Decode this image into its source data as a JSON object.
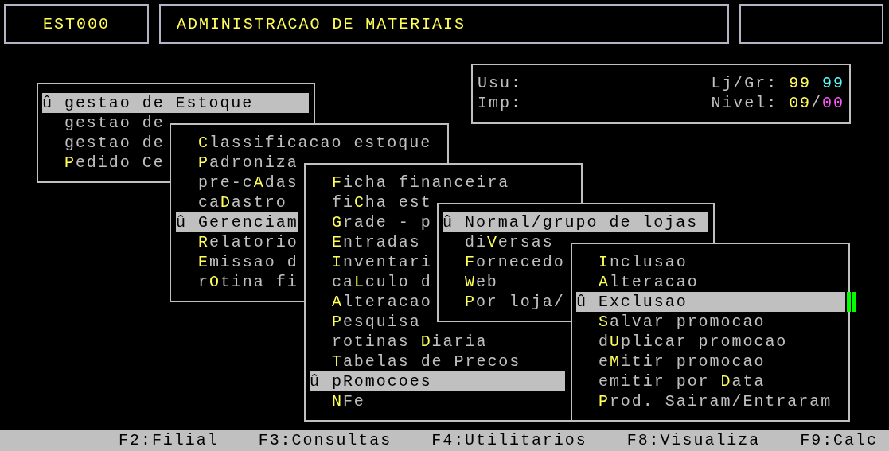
{
  "header": {
    "program_code": "EST000",
    "title": "ADMINISTRACAO DE MATERIAIS"
  },
  "info": {
    "user_label": "Usu:",
    "printer_label": "Imp:",
    "store_label": "Lj/Gr:",
    "store": "99",
    "group": "99",
    "level_label": "Nivel:",
    "level_a": "09",
    "separator": "/",
    "level_b": "00"
  },
  "menus": [
    {
      "items": [
        {
          "marker": "û",
          "label": "gestao de Estoque",
          "selected": true
        },
        {
          "label": "gestao de",
          "selected": false
        },
        {
          "label": "gestao de",
          "selected": false
        },
        {
          "label": "**P**edido Ce",
          "selected": false
        }
      ]
    },
    {
      "items": [
        {
          "label": "**C**lassificacao estoque",
          "selected": false
        },
        {
          "label": "**P**adroniza",
          "selected": false
        },
        {
          "label": "pre-c**A**das",
          "selected": false
        },
        {
          "label": "ca**D**astro",
          "selected": false
        },
        {
          "marker": "û",
          "label": "Gerenciam",
          "selected": true
        },
        {
          "label": "**R**elatorio",
          "selected": false
        },
        {
          "label": "**E**missao d",
          "selected": false
        },
        {
          "label": "r**O**tina fi",
          "selected": false
        }
      ]
    },
    {
      "items": [
        {
          "label": "**F**icha financeira",
          "selected": false
        },
        {
          "label": "fi**C**ha est",
          "selected": false
        },
        {
          "label": "**G**rade - p",
          "selected": false
        },
        {
          "label": "**E**ntradas",
          "selected": false
        },
        {
          "label": "**I**nventari",
          "selected": false
        },
        {
          "label": "ca**L**culo d",
          "selected": false
        },
        {
          "label": "**A**lteracao",
          "selected": false
        },
        {
          "label": "**P**esquisa",
          "selected": false
        },
        {
          "label": "rotinas **D**iaria",
          "selected": false
        },
        {
          "label": "**T**abelas de Precos",
          "selected": false
        },
        {
          "marker": "û",
          "label": "pRomocoes",
          "selected": true
        },
        {
          "label": "**N**Fe",
          "selected": false
        }
      ]
    },
    {
      "items": [
        {
          "marker": "û",
          "label": "Normal/grupo de lojas",
          "selected": true
        },
        {
          "label": "di**V**ersas",
          "selected": false
        },
        {
          "label": "**F**ornecedo",
          "selected": false
        },
        {
          "label": "**W**eb",
          "selected": false
        },
        {
          "label": "**P**or loja/",
          "selected": false
        }
      ]
    },
    {
      "items": [
        {
          "label": "**I**nclusao",
          "selected": false
        },
        {
          "label": "**A**lteracao",
          "selected": false
        },
        {
          "marker": "û",
          "label": "Exclusao",
          "selected": true
        },
        {
          "label": "**S**alvar promocao",
          "selected": false
        },
        {
          "label": "d**U**plicar promocao",
          "selected": false
        },
        {
          "label": "e**M**itir promocao",
          "selected": false
        },
        {
          "label": "emitir por **D**ata",
          "selected": false
        },
        {
          "label": "**P**rod. Sairam/Entraram",
          "selected": false
        }
      ]
    }
  ],
  "status_bar": [
    "F2:Filial",
    "F3:Consultas",
    "F4:Utilitarios",
    "F8:Visualiza",
    "F9:Calc"
  ]
}
